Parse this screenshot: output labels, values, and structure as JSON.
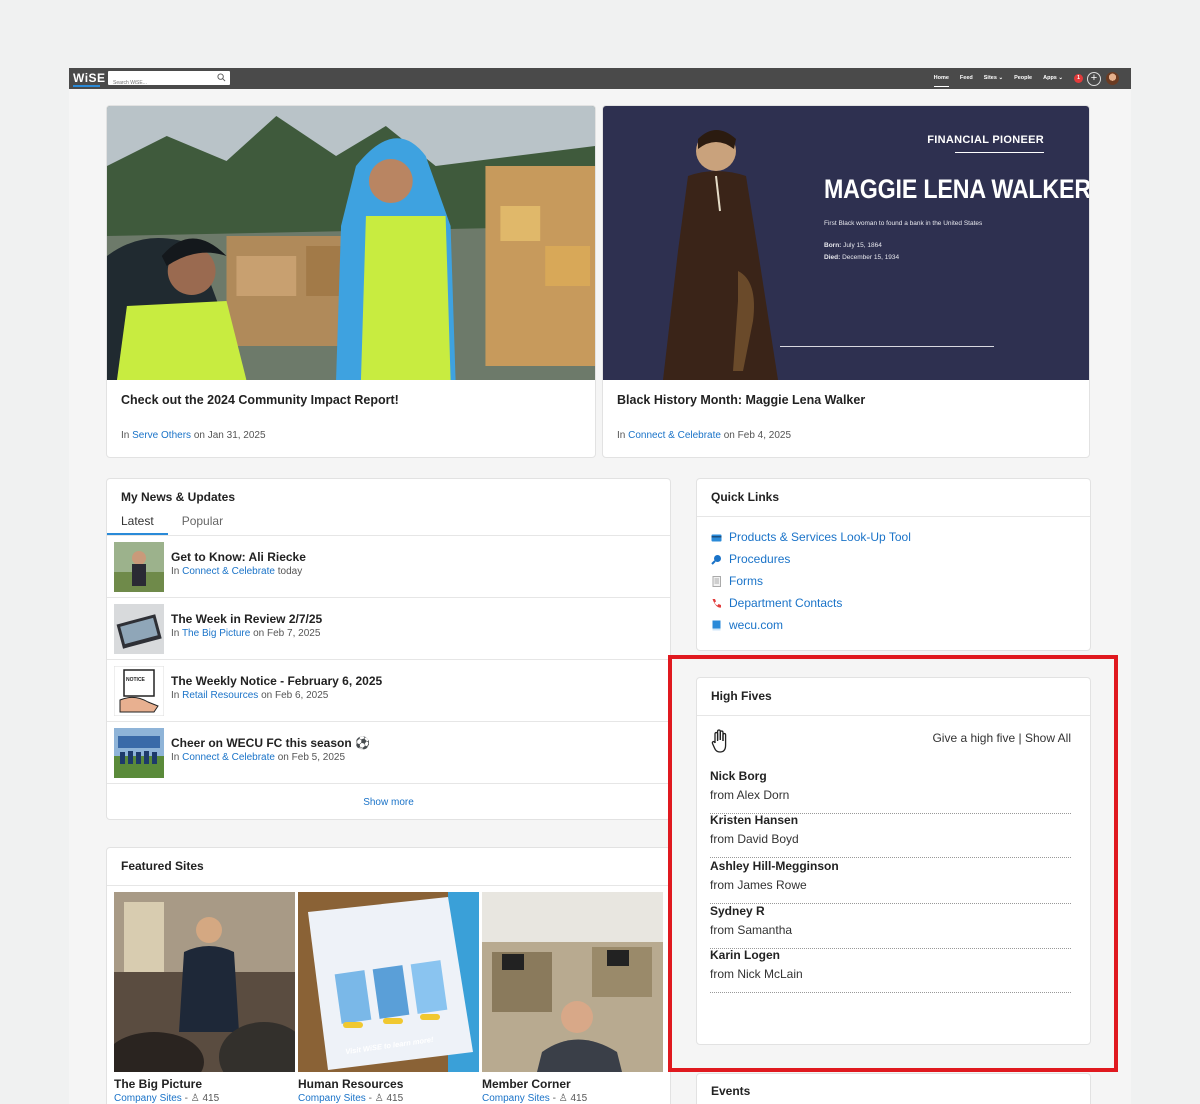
{
  "topbar": {
    "logo": "WiSE",
    "search_placeholder": "Search WiSE...",
    "nav": [
      "Home",
      "Feed",
      "Sites",
      "People",
      "Apps"
    ],
    "notification_count": "1",
    "plus_label": "+"
  },
  "hero": [
    {
      "title": "Check out the 2024 Community Impact Report!",
      "meta_prefix": "In",
      "meta_link": "Serve Others",
      "meta_suffix": "on Jan 31, 2025"
    },
    {
      "title": "Black History Month: Maggie Lena Walker",
      "meta_prefix": "In",
      "meta_link": "Connect & Celebrate",
      "meta_suffix": "on Feb 4, 2025",
      "banner": {
        "kicker": "FINANCIAL PIONEER",
        "name": "MAGGIE LENA WALKER",
        "description": "First Black woman to found a bank in the United States",
        "born_label": "Born:",
        "born_value": "July 15, 1864",
        "died_label": "Died:",
        "died_value": "December 15, 1934"
      }
    }
  ],
  "news": {
    "title": "My News & Updates",
    "tabs": [
      "Latest",
      "Popular"
    ],
    "items": [
      {
        "title": "Get to Know: Ali Riecke",
        "prefix": "In",
        "link": "Connect & Celebrate",
        "suffix": "today"
      },
      {
        "title": "The Week in Review 2/7/25",
        "prefix": "In",
        "link": "The Big Picture",
        "suffix": "on Feb 7, 2025"
      },
      {
        "title": "The Weekly Notice - February 6, 2025",
        "prefix": "In",
        "link": "Retail Resources",
        "suffix": "on Feb 6, 2025"
      },
      {
        "title": "Cheer on WECU FC this season",
        "prefix": "In",
        "link": "Connect & Celebrate",
        "suffix": "on Feb 5, 2025"
      }
    ],
    "notice_badge": "NOTICE",
    "show_more": "Show more"
  },
  "quick_links": {
    "title": "Quick Links",
    "items": [
      {
        "label": "Products & Services Look-Up Tool",
        "icon": "card-icon"
      },
      {
        "label": "Procedures",
        "icon": "magnifier-icon"
      },
      {
        "label": "Forms",
        "icon": "document-icon"
      },
      {
        "label": "Department Contacts",
        "icon": "phone-icon"
      },
      {
        "label": "wecu.com",
        "icon": "book-icon"
      }
    ]
  },
  "high_fives": {
    "title": "High Fives",
    "give_label": "Give a high five",
    "divider": "|",
    "show_all_label": "Show All",
    "items": [
      {
        "name": "Nick Borg",
        "from": "from Alex Dorn"
      },
      {
        "name": "Kristen Hansen",
        "from": "from David Boyd"
      },
      {
        "name": "Ashley Hill-Megginson",
        "from": "from James Rowe"
      },
      {
        "name": "Sydney R",
        "from": "from Samantha"
      },
      {
        "name": "Karin Logen",
        "from": "from Nick McLain"
      }
    ]
  },
  "featured_sites": {
    "title": "Featured Sites",
    "sites": [
      {
        "name": "The Big Picture",
        "category": "Company Sites",
        "dash": "-",
        "members": "415"
      },
      {
        "name": "Human Resources",
        "category": "Company Sites",
        "dash": "-",
        "members": "415"
      },
      {
        "name": "Member Corner",
        "category": "Company Sites",
        "dash": "-",
        "members": "415"
      }
    ],
    "flyer_text": "Visit WiSE to learn more!"
  },
  "events": {
    "title": "Events"
  },
  "colors": {
    "accent": "#1a73c8",
    "topbar": "#4a4a4a",
    "highlight": "#e0191f"
  }
}
